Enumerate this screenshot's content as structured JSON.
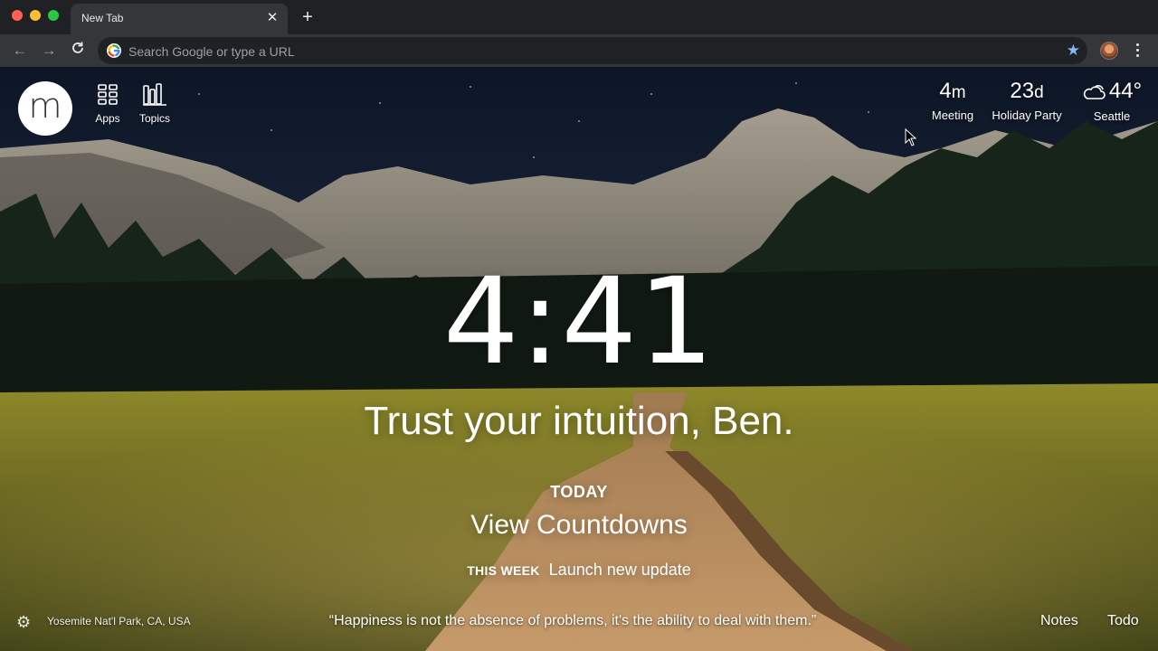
{
  "browser": {
    "tab_title": "New Tab",
    "omnibox_placeholder": "Search Google or type a URL"
  },
  "momentum": {
    "logo_letter": "m",
    "tools": [
      {
        "label": "Apps",
        "icon": "apps-grid-icon"
      },
      {
        "label": "Topics",
        "icon": "topics-bars-icon"
      }
    ],
    "widgets": [
      {
        "value": "4",
        "unit": "m",
        "label": "Meeting"
      },
      {
        "value": "23",
        "unit": "d",
        "label": "Holiday Party"
      },
      {
        "value": "44°",
        "unit": "",
        "label": "Seattle",
        "icon": "cloud-icon"
      }
    ],
    "clock": "4:41",
    "greeting": "Trust your intuition, Ben.",
    "today_label": "TODAY",
    "today_value": "View Countdowns",
    "week_label": "THIS WEEK",
    "week_value": "Launch new update",
    "location": "Yosemite Nat'l Park, CA, USA",
    "quote": "“Happiness is not the absence of problems, it's the ability to deal with them.”",
    "notes_label": "Notes",
    "todo_label": "Todo"
  }
}
